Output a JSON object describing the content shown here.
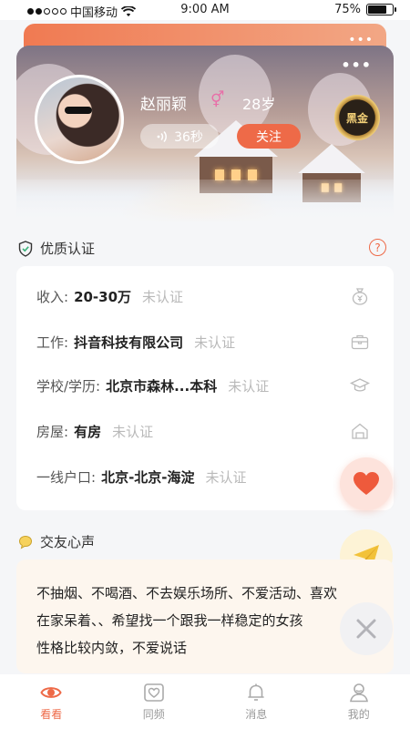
{
  "status_bar": {
    "carrier": "中国移动",
    "time": "9:00 AM",
    "battery": "75%",
    "battery_level": 0.75
  },
  "profile": {
    "name": "赵丽颖",
    "gender_icon": "female-male-symbol-icon",
    "age": "28岁",
    "voice_duration": "36秒",
    "follow_label": "关注",
    "vip_badge": "黑金",
    "more_label": "•••"
  },
  "verification": {
    "title": "优质认证",
    "help_label": "?",
    "rows": [
      {
        "label": "收入:",
        "value": "20-30万",
        "status": "未认证",
        "icon": "money-bag-icon"
      },
      {
        "label": "工作:",
        "value": "抖音科技有限公司",
        "status": "未认证",
        "icon": "briefcase-icon"
      },
      {
        "label": "学校/学历:",
        "value": "北京市森林...本科",
        "status": "未认证",
        "icon": "graduation-cap-icon"
      },
      {
        "label": "房屋:",
        "value": "有房",
        "status": "未认证",
        "icon": "house-icon"
      },
      {
        "label": "一线户口:",
        "value": "北京-北京-海淀",
        "status": "未认证",
        "icon": "id-card-icon"
      }
    ]
  },
  "bio": {
    "title": "交友心声",
    "text": "不抽烟、不喝酒、不去娱乐场所、不爱活动、喜欢\n在家呆着、、希望找一个跟我一样稳定的女孩\n性格比较内敛，不爱说话"
  },
  "tabs": [
    {
      "label": "看看",
      "icon": "eye-icon",
      "active": true
    },
    {
      "label": "同频",
      "icon": "heart-frame-icon",
      "active": false
    },
    {
      "label": "消息",
      "icon": "bell-icon",
      "active": false
    },
    {
      "label": "我的",
      "icon": "user-icon",
      "active": false
    }
  ],
  "colors": {
    "accent": "#ee6a48",
    "bio_bg": "#fdf6ee",
    "muted": "#b9b9b9"
  }
}
